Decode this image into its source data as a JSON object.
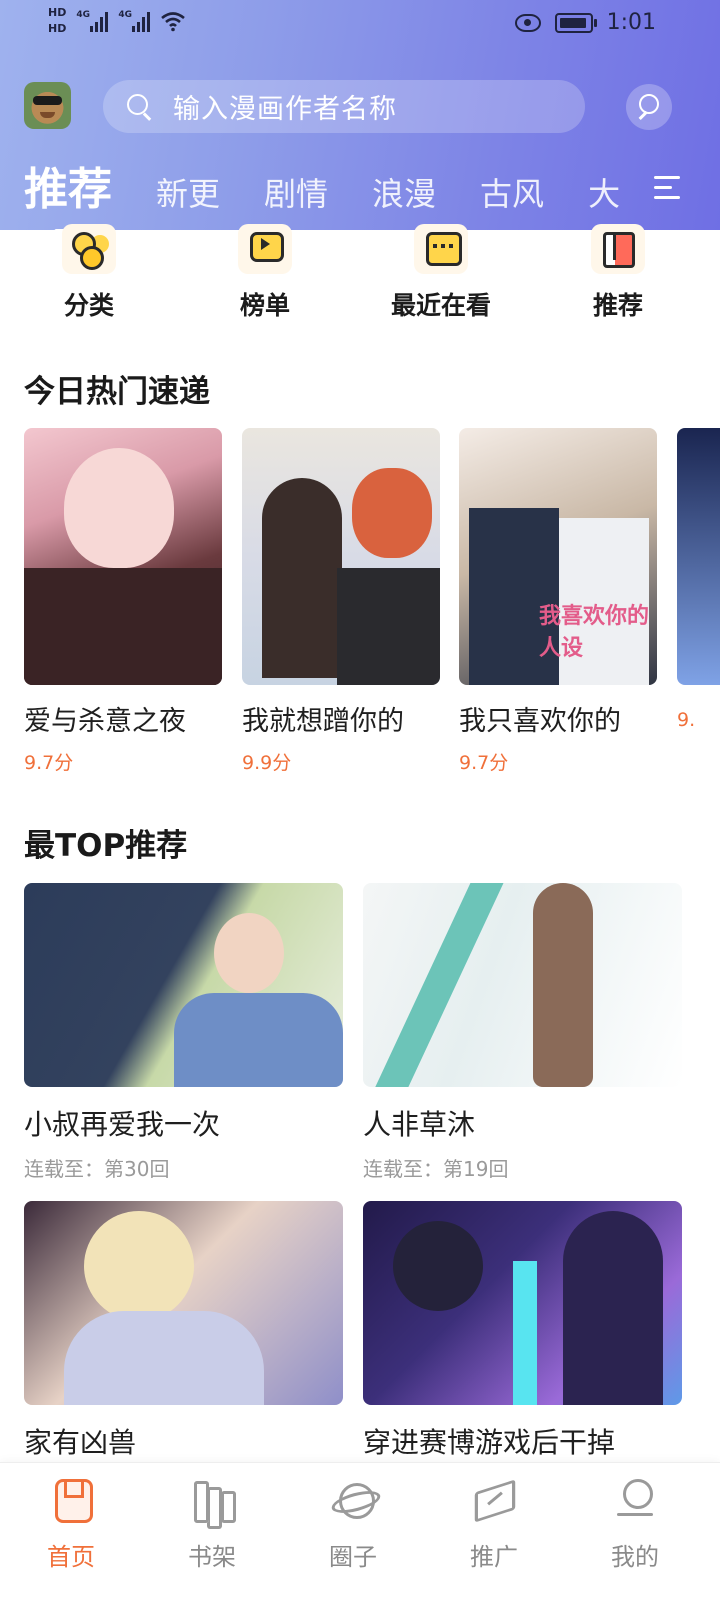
{
  "status_bar": {
    "hd1": "HD",
    "hd2": "HD",
    "net1": "4G",
    "net2": "4G",
    "time": "1:01"
  },
  "search": {
    "placeholder": "输入漫画作者名称"
  },
  "tabs": [
    {
      "label": "推荐"
    },
    {
      "label": "新更"
    },
    {
      "label": "剧情"
    },
    {
      "label": "浪漫"
    },
    {
      "label": "古风"
    },
    {
      "label": "大"
    }
  ],
  "quick_links": [
    {
      "label": "分类",
      "icon": "category-icon"
    },
    {
      "label": "榜单",
      "icon": "ranking-icon"
    },
    {
      "label": "最近在看",
      "icon": "recent-icon"
    },
    {
      "label": "推荐",
      "icon": "recommend-icon"
    }
  ],
  "hot_section": {
    "title": "今日热门速递",
    "items": [
      {
        "title": "爱与杀意之夜",
        "score": "9.7分"
      },
      {
        "title": "我就想蹭你的",
        "score": "9.9分"
      },
      {
        "title": "我只喜欢你的",
        "score": "9.7分"
      },
      {
        "title": "",
        "score": "9."
      }
    ]
  },
  "cover_text": {
    "hot3": "我喜欢你的人设"
  },
  "top_section": {
    "title": "最TOP推荐",
    "items": [
      {
        "title": "小叔再爱我一次",
        "progress": "连载至：第30回"
      },
      {
        "title": "人非草沐",
        "progress": "连载至：第19回"
      },
      {
        "title": "家有凶兽",
        "progress": ""
      },
      {
        "title": "穿进赛博游戏后干掉",
        "progress": ""
      }
    ]
  },
  "bottom_nav": [
    {
      "label": "首页",
      "active": true
    },
    {
      "label": "书架",
      "active": false
    },
    {
      "label": "圈子",
      "active": false
    },
    {
      "label": "推广",
      "active": false
    },
    {
      "label": "我的",
      "active": false
    }
  ],
  "colors": {
    "accent": "#f0703a",
    "header_start": "#9fb2ee",
    "header_end": "#6f6fe4",
    "muted_text": "#9a9a9a"
  }
}
